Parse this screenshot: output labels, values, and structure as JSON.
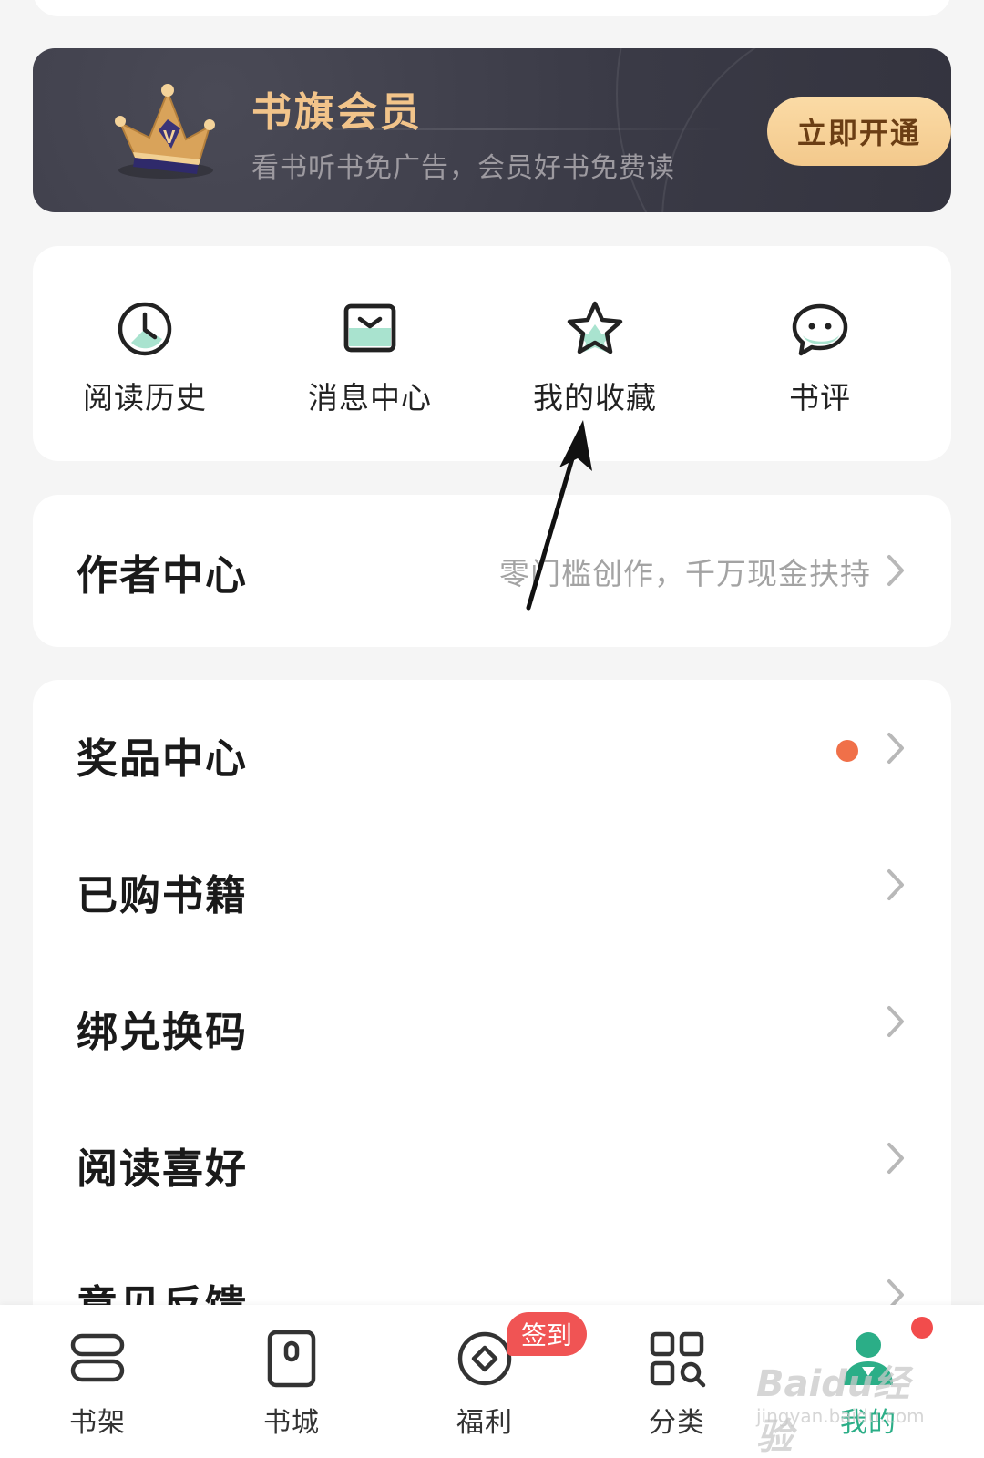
{
  "vip_banner": {
    "title": "书旗会员",
    "subtitle": "看书听书免广告，会员好书免费读",
    "button_label": "立即开通",
    "crown_letter": "V"
  },
  "quick_actions": [
    {
      "label": "阅读历史",
      "icon": "clock-icon"
    },
    {
      "label": "消息中心",
      "icon": "inbox-icon"
    },
    {
      "label": "我的收藏",
      "icon": "star-icon"
    },
    {
      "label": "书评",
      "icon": "chat-bubble-icon"
    }
  ],
  "author_center": {
    "title": "作者中心",
    "hint": "零门槛创作，千万现金扶持"
  },
  "menu_rows": [
    {
      "label": "奖品中心",
      "has_dot": true
    },
    {
      "label": "已购书籍"
    },
    {
      "label": "绑兑换码"
    },
    {
      "label": "阅读喜好"
    },
    {
      "label": "意见反馈"
    }
  ],
  "tabbar": {
    "tabs": [
      {
        "label": "书架",
        "icon": "bookshelf-icon"
      },
      {
        "label": "书城",
        "icon": "bookstore-icon"
      },
      {
        "label": "福利",
        "icon": "coin-icon"
      },
      {
        "label": "分类",
        "icon": "category-grid-icon"
      },
      {
        "label": "我的",
        "icon": "profile-icon",
        "active": true
      }
    ],
    "welfare_badge": "签到"
  },
  "watermark": {
    "main": "Baidu经验",
    "sub": "jingyan.baidu.com"
  },
  "colors": {
    "accent": "#2bae87",
    "vip_gold": "#f2c48a",
    "alert_red": "#f05454",
    "dot_orange": "#f07049"
  }
}
